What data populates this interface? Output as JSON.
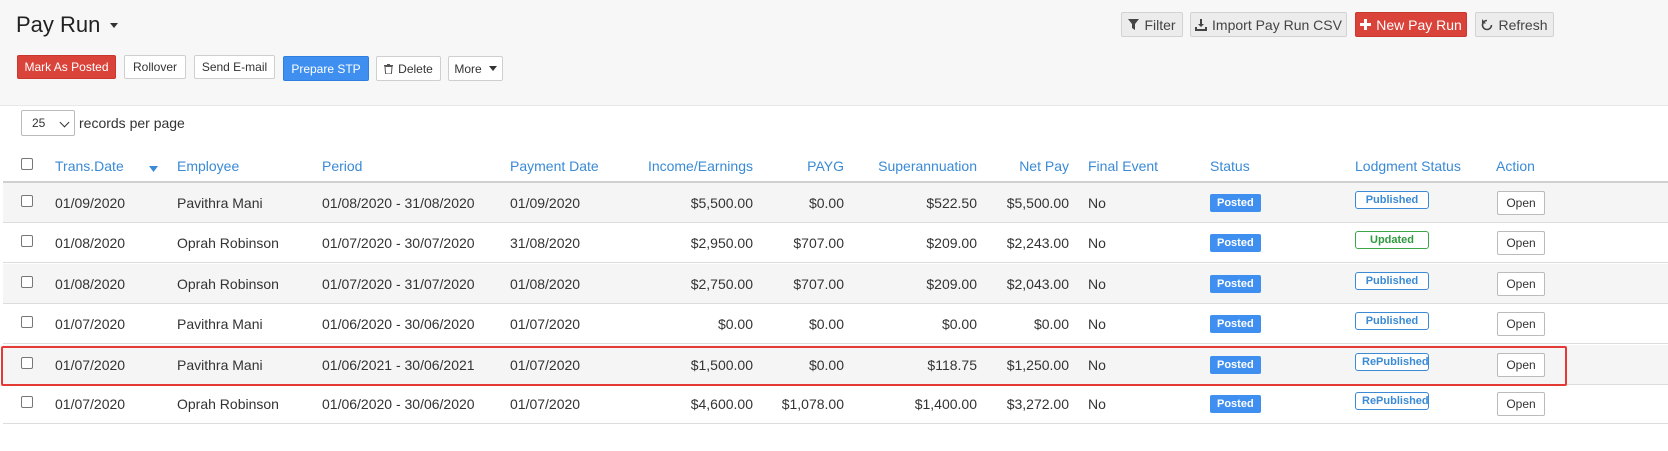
{
  "page": {
    "title": "Pay Run"
  },
  "toolbar": {
    "filter_label": "Filter",
    "import_label": "Import Pay Run CSV",
    "new_label": "New Pay Run",
    "refresh_label": "Refresh",
    "mark_posted_label": "Mark As Posted",
    "rollover_label": "Rollover",
    "send_email_label": "Send E-mail",
    "prepare_stp_label": "Prepare STP",
    "delete_label": "Delete",
    "more_label": "More"
  },
  "paging": {
    "records_per_page_value": "25",
    "records_per_page_label": "records per page"
  },
  "colors": {
    "accent_blue": "#3f8ff0",
    "danger_red": "#d9433a",
    "link_blue": "#3a8ad6",
    "success_green": "#3aa64a"
  },
  "table": {
    "columns": [
      "Trans.Date",
      "Employee",
      "Period",
      "Payment Date",
      "Income/Earnings",
      "PAYG",
      "Superannuation",
      "Net Pay",
      "Final Event",
      "Status",
      "Lodgment Status",
      "Action"
    ],
    "sort_icon": "sort-desc-icon",
    "rows": [
      {
        "trans_date": "01/09/2020",
        "employee": "Pavithra Mani",
        "period": "01/08/2020 - 31/08/2020",
        "payment_date": "01/09/2020",
        "income": "$5,500.00",
        "payg": "$0.00",
        "super": "$522.50",
        "net_pay": "$5,500.00",
        "final_event": "No",
        "status": "Posted",
        "lodgment": "Published",
        "action": "Open"
      },
      {
        "trans_date": "01/08/2020",
        "employee": "Oprah Robinson",
        "period": "01/07/2020 - 30/07/2020",
        "payment_date": "31/08/2020",
        "income": "$2,950.00",
        "payg": "$707.00",
        "super": "$209.00",
        "net_pay": "$2,243.00",
        "final_event": "No",
        "status": "Posted",
        "lodgment": "Updated",
        "action": "Open"
      },
      {
        "trans_date": "01/08/2020",
        "employee": "Oprah Robinson",
        "period": "01/07/2020 - 31/07/2020",
        "payment_date": "01/08/2020",
        "income": "$2,750.00",
        "payg": "$707.00",
        "super": "$209.00",
        "net_pay": "$2,043.00",
        "final_event": "No",
        "status": "Posted",
        "lodgment": "Published",
        "action": "Open"
      },
      {
        "trans_date": "01/07/2020",
        "employee": "Pavithra Mani",
        "period": "01/06/2020 - 30/06/2020",
        "payment_date": "01/07/2020",
        "income": "$0.00",
        "payg": "$0.00",
        "super": "$0.00",
        "net_pay": "$0.00",
        "final_event": "No",
        "status": "Posted",
        "lodgment": "Published",
        "action": "Open"
      },
      {
        "trans_date": "01/07/2020",
        "employee": "Pavithra Mani",
        "period": "01/06/2021 - 30/06/2021",
        "payment_date": "01/07/2020",
        "income": "$1,500.00",
        "payg": "$0.00",
        "super": "$118.75",
        "net_pay": "$1,250.00",
        "final_event": "No",
        "status": "Posted",
        "lodgment": "RePublished",
        "action": "Open"
      },
      {
        "trans_date": "01/07/2020",
        "employee": "Oprah Robinson",
        "period": "01/06/2020 - 30/06/2020",
        "payment_date": "01/07/2020",
        "income": "$4,600.00",
        "payg": "$1,078.00",
        "super": "$1,400.00",
        "net_pay": "$3,272.00",
        "final_event": "No",
        "status": "Posted",
        "lodgment": "RePublished",
        "action": "Open"
      }
    ]
  }
}
